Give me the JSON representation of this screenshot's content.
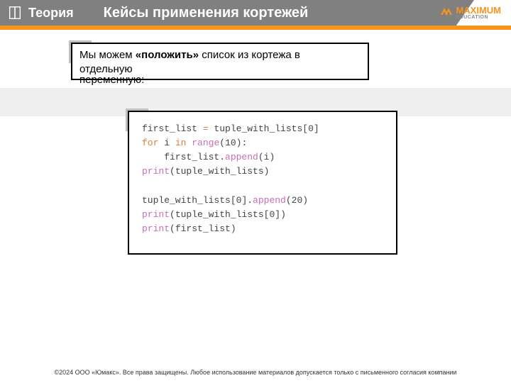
{
  "banner": {
    "section_label": "Теория",
    "title": "Кейсы применения кортежей",
    "brand": "MAXIMUM",
    "brand_sub": "EDUCATION"
  },
  "callout": {
    "line1_a": "Мы можем ",
    "line1_b": "«положить»",
    "line1_c": " список из кортежа в",
    "line2": "отдельную",
    "line3": "переменную:"
  },
  "code": {
    "l1_a": "first_list ",
    "l1_eq": "=",
    "l1_b": " tuple_with_lists[",
    "l1_idx": "0",
    "l1_c": "]",
    "l2_for": "for",
    "l2_a": " i ",
    "l2_in": "in",
    "l2_sp": " ",
    "l2_range": "range",
    "l2_b": "(",
    "l2_n": "10",
    "l2_c": "):",
    "l3_a": "    first_list.",
    "l3_fn": "append",
    "l3_b": "(i)",
    "l4_fn": "print",
    "l4_a": "(tuple_with_lists)",
    "l5": "",
    "l6_a": "tuple_with_lists[",
    "l6_idx": "0",
    "l6_b": "].",
    "l6_fn": "append",
    "l6_c": "(",
    "l6_n": "20",
    "l6_d": ")",
    "l7_fn": "print",
    "l7_a": "(tuple_with_lists[",
    "l7_idx": "0",
    "l7_b": "])",
    "l8_fn": "print",
    "l8_a": "(first_list)"
  },
  "footer": "©2024 ООО «Юмакс». Все права защищены. Любое использование материалов допускается только с письменного согласия компании"
}
